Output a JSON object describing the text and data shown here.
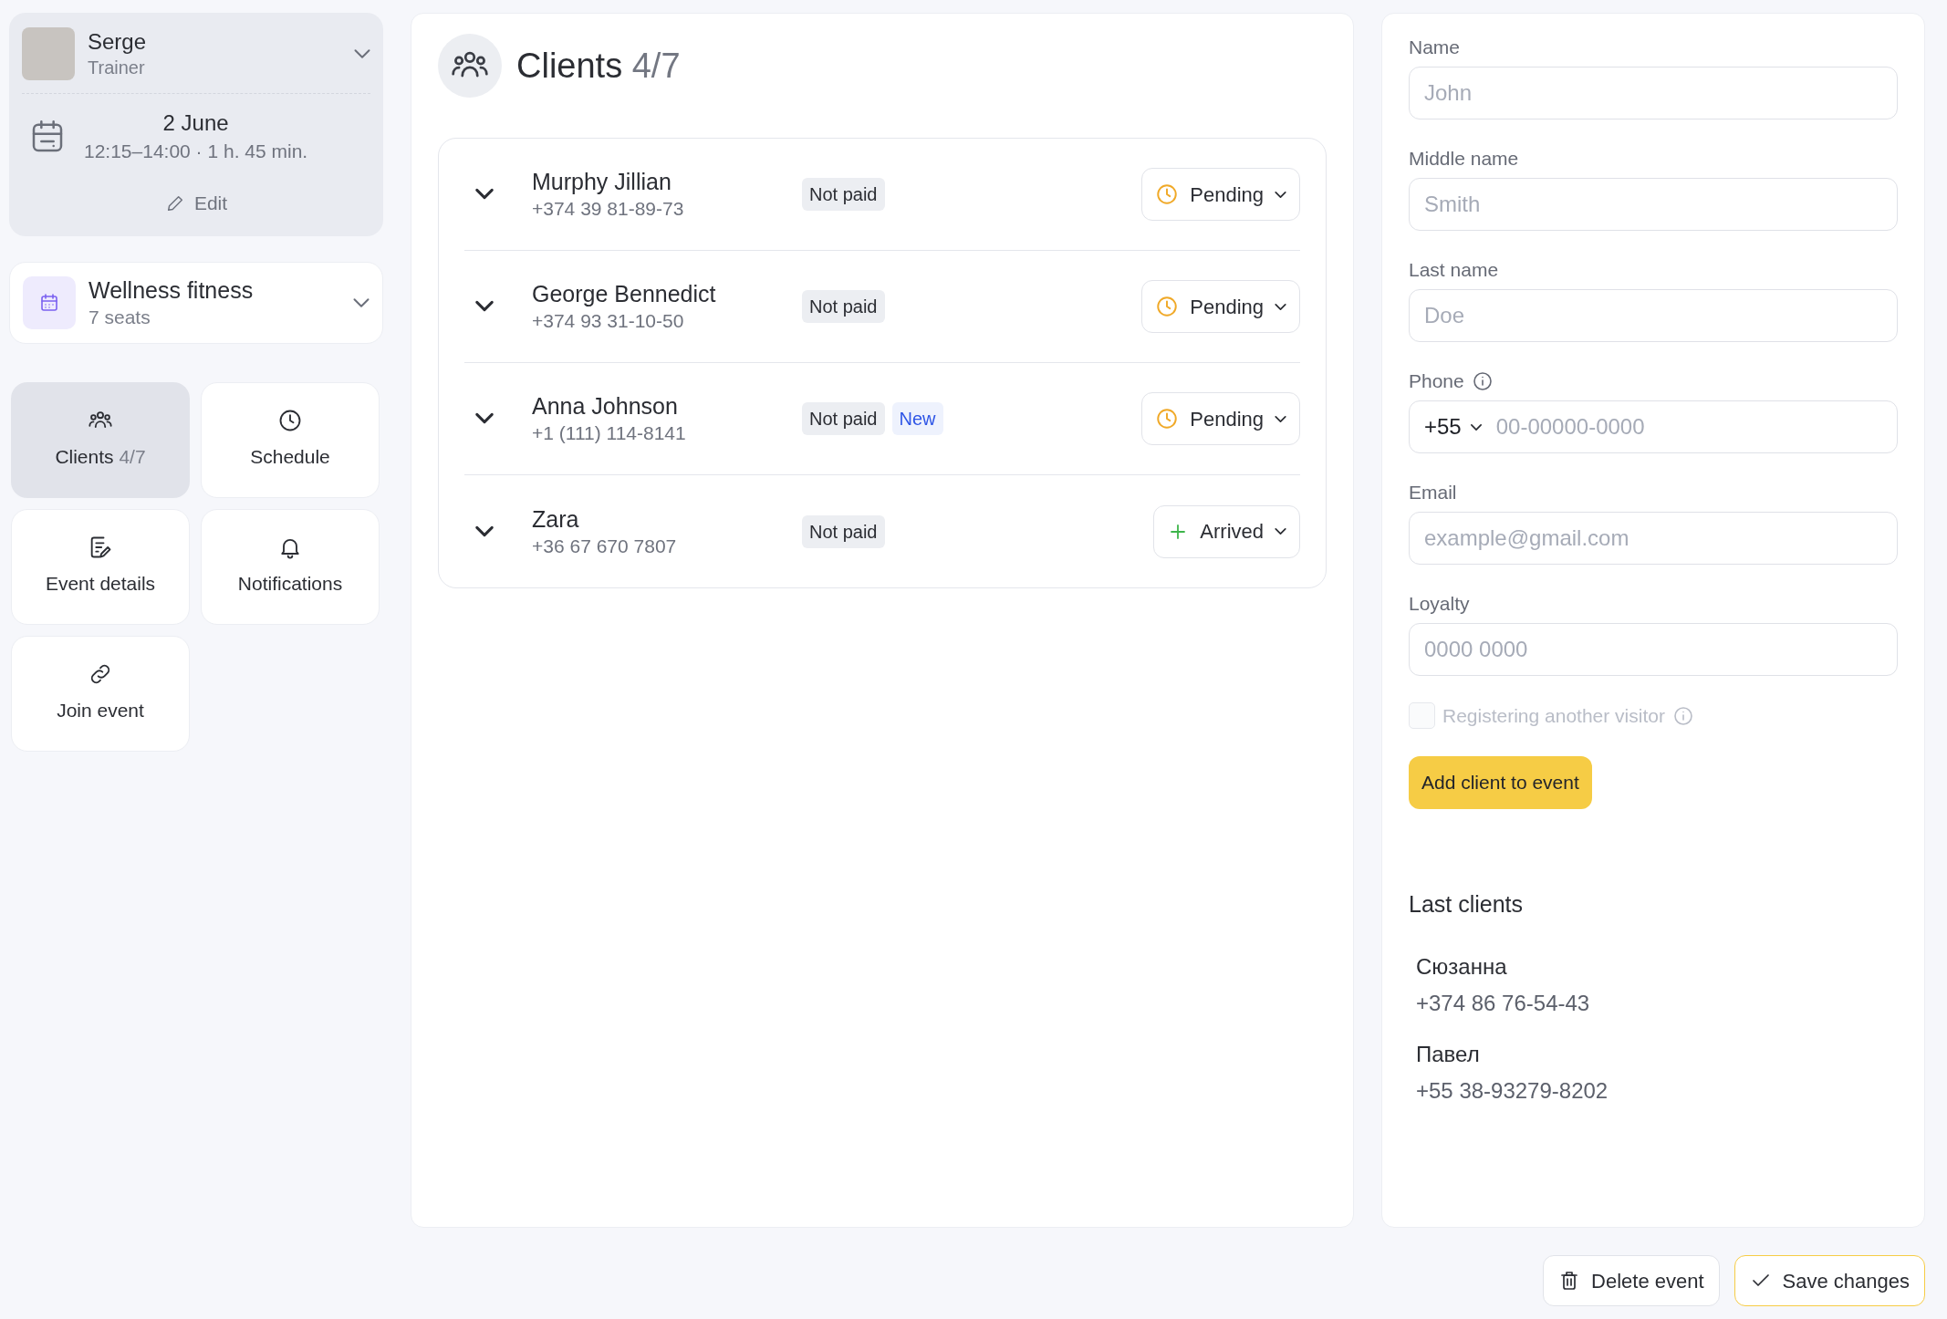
{
  "profile": {
    "name": "Serge",
    "role": "Trainer"
  },
  "event": {
    "date": "2 June",
    "time": "12:15–14:00 · 1 h. 45 min.",
    "edit": "Edit"
  },
  "activity": {
    "name": "Wellness fitness",
    "seats": "7 seats"
  },
  "nav": [
    {
      "kind": "clients",
      "label": "Clients",
      "count": "4/7",
      "selected": true
    },
    {
      "kind": "schedule",
      "label": "Schedule",
      "selected": false
    },
    {
      "kind": "details",
      "label": "Event details",
      "selected": false
    },
    {
      "kind": "notifications",
      "label": "Notifications",
      "selected": false
    },
    {
      "kind": "link",
      "label": "Join event",
      "selected": false
    }
  ],
  "header": {
    "title": "Clients",
    "count": "4/7"
  },
  "clients": [
    {
      "expanded": false,
      "name": "Murphy Jillian",
      "phone": "+374 39 81-89-73",
      "tags": [
        {
          "kind": "payment",
          "label": "Not paid"
        }
      ],
      "status": {
        "kind": "pending",
        "label": "Pending"
      }
    },
    {
      "expanded": false,
      "name": "George Bennedict",
      "phone": "+374 93 31-10-50",
      "tags": [
        {
          "kind": "payment",
          "label": "Not paid"
        }
      ],
      "status": {
        "kind": "pending",
        "label": "Pending"
      }
    },
    {
      "expanded": false,
      "name": "Anna Johnson",
      "phone": "+1 (111) 114-8141",
      "tags": [
        {
          "kind": "payment",
          "label": "Not paid"
        },
        {
          "kind": "new",
          "label": "New"
        }
      ],
      "status": {
        "kind": "pending",
        "label": "Pending"
      }
    },
    {
      "expanded": false,
      "name": "Zara",
      "phone": "+36 67 670 7807",
      "tags": [
        {
          "kind": "payment",
          "label": "Not paid"
        }
      ],
      "status": {
        "kind": "arrived",
        "label": "Arrived"
      }
    }
  ],
  "form": {
    "fields": [
      {
        "kind": "text",
        "label": "Name",
        "placeholder": "John"
      },
      {
        "kind": "text",
        "label": "Middle name",
        "placeholder": "Smith"
      },
      {
        "kind": "text",
        "label": "Last name",
        "placeholder": "Doe"
      },
      {
        "kind": "phone",
        "label": "Phone",
        "info": true,
        "code": "+55",
        "placeholder": "00-00000-0000"
      },
      {
        "kind": "text",
        "label": "Email",
        "placeholder": "example@gmail.com"
      },
      {
        "kind": "text",
        "label": "Loyalty",
        "placeholder": "0000 0000"
      }
    ],
    "checkbox": {
      "label": "Registering another visitor",
      "checked": false,
      "disabled": true
    },
    "submit": "Add client to event"
  },
  "last_clients": {
    "title": "Last clients",
    "items": [
      {
        "name": "Сюзанна",
        "phone": "+374 86 76-54-43"
      },
      {
        "name": "Павел",
        "phone": "+55 38-93279-8202"
      }
    ]
  },
  "actions": [
    {
      "kind": "delete",
      "label": "Delete event"
    },
    {
      "kind": "save",
      "label": "Save changes"
    }
  ]
}
